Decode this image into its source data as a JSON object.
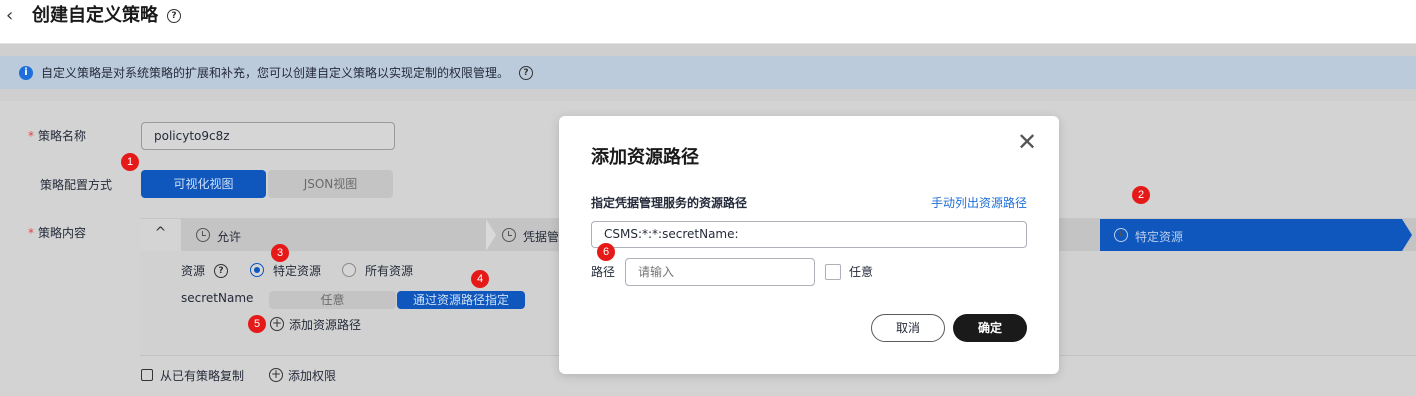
{
  "header": {
    "back_glyph": "‹",
    "title": "创建自定义策略",
    "help": "?"
  },
  "info": {
    "icon": "i",
    "text": "自定义策略是对系统策略的扩展和补充，您可以创建自定义策略以实现定制的权限管理。",
    "help": "?"
  },
  "form": {
    "name_required": "*",
    "name_label": "策略名称",
    "name_value": "policyto9c8z",
    "mode_label": "策略配置方式",
    "mode_visual": "可视化视图",
    "mode_json": "JSON视图",
    "content_required": "*",
    "content_label": "策略内容"
  },
  "steps": {
    "collapse": "^",
    "allow": "允许",
    "service": "凭据管",
    "resource": "特定资源"
  },
  "resource": {
    "label": "资源",
    "help": "?",
    "specific": "特定资源",
    "all": "所有资源",
    "secret_label": "secretName",
    "any": "任意",
    "by_path": "通过资源路径指定",
    "add_path": "添加资源路径"
  },
  "footer": {
    "copy": "从已有策略复制",
    "add_perm": "添加权限"
  },
  "badges": [
    "1",
    "2",
    "3",
    "4",
    "5",
    "6"
  ],
  "modal": {
    "title": "添加资源路径",
    "close": "✕",
    "subtitle": "指定凭据管理服务的资源路径",
    "manual_link": "手动列出资源路径",
    "path_value": "CSMS:*:*:secretName:",
    "path_label": "路径",
    "path_placeholder": "请输入",
    "any_label": "任意",
    "cancel": "取消",
    "confirm": "确定"
  },
  "colors": {
    "primary": "#0f57bd",
    "link": "#1e6fd9",
    "badge": "#e61919",
    "confirm_bg": "#1a1a1a"
  }
}
